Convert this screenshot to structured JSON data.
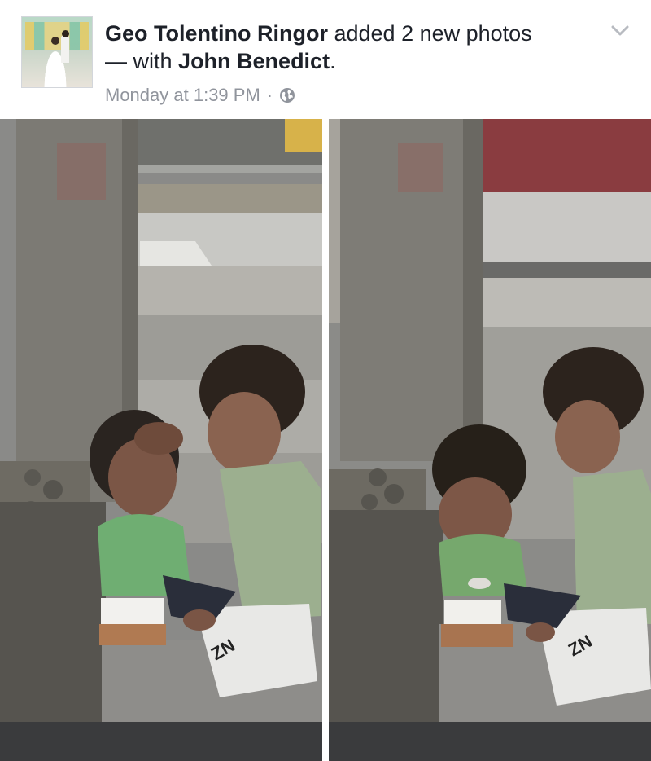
{
  "post": {
    "author": {
      "name": "Geo Tolentino Ringor",
      "avatar_icon": "profile-photo-wedding"
    },
    "action_text": "added 2 new photos",
    "with_text": "— with",
    "tagged_name": "John Benedict",
    "tagged_suffix": ".",
    "timestamp": "Monday at 1:39 PM",
    "separator": "·",
    "privacy_icon": "globe-icon",
    "menu_icon": "chevron-down-icon",
    "photos_count": 2
  },
  "colors": {
    "text_primary": "#1d2129",
    "text_secondary": "#90949c",
    "background": "#ffffff"
  }
}
